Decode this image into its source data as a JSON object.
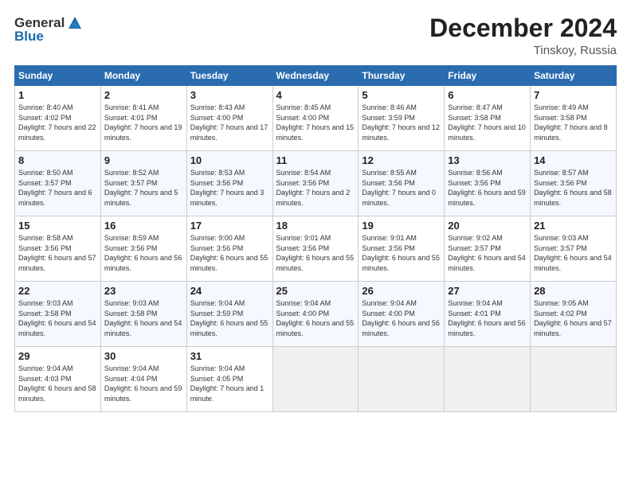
{
  "logo": {
    "general": "General",
    "blue": "Blue"
  },
  "title": "December 2024",
  "location": "Tinskoy, Russia",
  "days_header": [
    "Sunday",
    "Monday",
    "Tuesday",
    "Wednesday",
    "Thursday",
    "Friday",
    "Saturday"
  ],
  "weeks": [
    [
      {
        "num": "1",
        "sunrise": "Sunrise: 8:40 AM",
        "sunset": "Sunset: 4:02 PM",
        "daylight": "Daylight: 7 hours and 22 minutes."
      },
      {
        "num": "2",
        "sunrise": "Sunrise: 8:41 AM",
        "sunset": "Sunset: 4:01 PM",
        "daylight": "Daylight: 7 hours and 19 minutes."
      },
      {
        "num": "3",
        "sunrise": "Sunrise: 8:43 AM",
        "sunset": "Sunset: 4:00 PM",
        "daylight": "Daylight: 7 hours and 17 minutes."
      },
      {
        "num": "4",
        "sunrise": "Sunrise: 8:45 AM",
        "sunset": "Sunset: 4:00 PM",
        "daylight": "Daylight: 7 hours and 15 minutes."
      },
      {
        "num": "5",
        "sunrise": "Sunrise: 8:46 AM",
        "sunset": "Sunset: 3:59 PM",
        "daylight": "Daylight: 7 hours and 12 minutes."
      },
      {
        "num": "6",
        "sunrise": "Sunrise: 8:47 AM",
        "sunset": "Sunset: 3:58 PM",
        "daylight": "Daylight: 7 hours and 10 minutes."
      },
      {
        "num": "7",
        "sunrise": "Sunrise: 8:49 AM",
        "sunset": "Sunset: 3:58 PM",
        "daylight": "Daylight: 7 hours and 8 minutes."
      }
    ],
    [
      {
        "num": "8",
        "sunrise": "Sunrise: 8:50 AM",
        "sunset": "Sunset: 3:57 PM",
        "daylight": "Daylight: 7 hours and 6 minutes."
      },
      {
        "num": "9",
        "sunrise": "Sunrise: 8:52 AM",
        "sunset": "Sunset: 3:57 PM",
        "daylight": "Daylight: 7 hours and 5 minutes."
      },
      {
        "num": "10",
        "sunrise": "Sunrise: 8:53 AM",
        "sunset": "Sunset: 3:56 PM",
        "daylight": "Daylight: 7 hours and 3 minutes."
      },
      {
        "num": "11",
        "sunrise": "Sunrise: 8:54 AM",
        "sunset": "Sunset: 3:56 PM",
        "daylight": "Daylight: 7 hours and 2 minutes."
      },
      {
        "num": "12",
        "sunrise": "Sunrise: 8:55 AM",
        "sunset": "Sunset: 3:56 PM",
        "daylight": "Daylight: 7 hours and 0 minutes."
      },
      {
        "num": "13",
        "sunrise": "Sunrise: 8:56 AM",
        "sunset": "Sunset: 3:56 PM",
        "daylight": "Daylight: 6 hours and 59 minutes."
      },
      {
        "num": "14",
        "sunrise": "Sunrise: 8:57 AM",
        "sunset": "Sunset: 3:56 PM",
        "daylight": "Daylight: 6 hours and 58 minutes."
      }
    ],
    [
      {
        "num": "15",
        "sunrise": "Sunrise: 8:58 AM",
        "sunset": "Sunset: 3:56 PM",
        "daylight": "Daylight: 6 hours and 57 minutes."
      },
      {
        "num": "16",
        "sunrise": "Sunrise: 8:59 AM",
        "sunset": "Sunset: 3:56 PM",
        "daylight": "Daylight: 6 hours and 56 minutes."
      },
      {
        "num": "17",
        "sunrise": "Sunrise: 9:00 AM",
        "sunset": "Sunset: 3:56 PM",
        "daylight": "Daylight: 6 hours and 55 minutes."
      },
      {
        "num": "18",
        "sunrise": "Sunrise: 9:01 AM",
        "sunset": "Sunset: 3:56 PM",
        "daylight": "Daylight: 6 hours and 55 minutes."
      },
      {
        "num": "19",
        "sunrise": "Sunrise: 9:01 AM",
        "sunset": "Sunset: 3:56 PM",
        "daylight": "Daylight: 6 hours and 55 minutes."
      },
      {
        "num": "20",
        "sunrise": "Sunrise: 9:02 AM",
        "sunset": "Sunset: 3:57 PM",
        "daylight": "Daylight: 6 hours and 54 minutes."
      },
      {
        "num": "21",
        "sunrise": "Sunrise: 9:03 AM",
        "sunset": "Sunset: 3:57 PM",
        "daylight": "Daylight: 6 hours and 54 minutes."
      }
    ],
    [
      {
        "num": "22",
        "sunrise": "Sunrise: 9:03 AM",
        "sunset": "Sunset: 3:58 PM",
        "daylight": "Daylight: 6 hours and 54 minutes."
      },
      {
        "num": "23",
        "sunrise": "Sunrise: 9:03 AM",
        "sunset": "Sunset: 3:58 PM",
        "daylight": "Daylight: 6 hours and 54 minutes."
      },
      {
        "num": "24",
        "sunrise": "Sunrise: 9:04 AM",
        "sunset": "Sunset: 3:59 PM",
        "daylight": "Daylight: 6 hours and 55 minutes."
      },
      {
        "num": "25",
        "sunrise": "Sunrise: 9:04 AM",
        "sunset": "Sunset: 4:00 PM",
        "daylight": "Daylight: 6 hours and 55 minutes."
      },
      {
        "num": "26",
        "sunrise": "Sunrise: 9:04 AM",
        "sunset": "Sunset: 4:00 PM",
        "daylight": "Daylight: 6 hours and 56 minutes."
      },
      {
        "num": "27",
        "sunrise": "Sunrise: 9:04 AM",
        "sunset": "Sunset: 4:01 PM",
        "daylight": "Daylight: 6 hours and 56 minutes."
      },
      {
        "num": "28",
        "sunrise": "Sunrise: 9:05 AM",
        "sunset": "Sunset: 4:02 PM",
        "daylight": "Daylight: 6 hours and 57 minutes."
      }
    ],
    [
      {
        "num": "29",
        "sunrise": "Sunrise: 9:04 AM",
        "sunset": "Sunset: 4:03 PM",
        "daylight": "Daylight: 6 hours and 58 minutes."
      },
      {
        "num": "30",
        "sunrise": "Sunrise: 9:04 AM",
        "sunset": "Sunset: 4:04 PM",
        "daylight": "Daylight: 6 hours and 59 minutes."
      },
      {
        "num": "31",
        "sunrise": "Sunrise: 9:04 AM",
        "sunset": "Sunset: 4:05 PM",
        "daylight": "Daylight: 7 hours and 1 minute."
      },
      {
        "num": "",
        "sunrise": "",
        "sunset": "",
        "daylight": ""
      },
      {
        "num": "",
        "sunrise": "",
        "sunset": "",
        "daylight": ""
      },
      {
        "num": "",
        "sunrise": "",
        "sunset": "",
        "daylight": ""
      },
      {
        "num": "",
        "sunrise": "",
        "sunset": "",
        "daylight": ""
      }
    ]
  ]
}
